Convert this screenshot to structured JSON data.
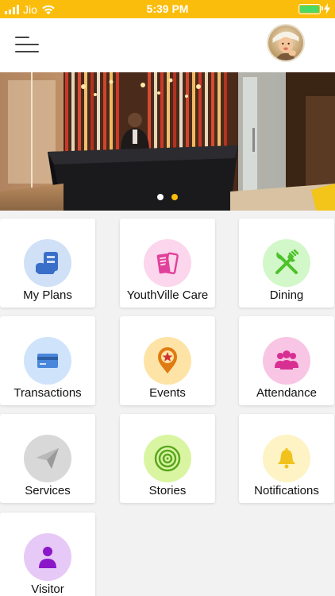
{
  "status_bar": {
    "carrier": "Jio",
    "time": "5:39 PM",
    "signal_icon": "signal-bars-icon",
    "wifi_icon": "wifi-icon",
    "battery_icon": "battery-icon",
    "charging_icon": "charging-bolt-icon",
    "battery_level": 1.0
  },
  "header": {
    "menu_icon": "hamburger-menu-icon",
    "avatar_icon": "profile-avatar"
  },
  "banner": {
    "slide_count": 2,
    "active_slide": 2
  },
  "menu": {
    "items": [
      {
        "label": "My Plans",
        "icon": "plans-icon",
        "bg": "#cfe0f7",
        "color": "#3a6fc9"
      },
      {
        "label": "YouthVille Care",
        "icon": "tickets-icon",
        "bg": "#fbd6ec",
        "color": "#e0419a"
      },
      {
        "label": "Dining",
        "icon": "fork-knife-icon",
        "bg": "#d2f7c8",
        "color": "#4cc22a"
      },
      {
        "label": "Transactions",
        "icon": "credit-card-icon",
        "bg": "#cfe4fb",
        "color": "#4a86d9"
      },
      {
        "label": "Events",
        "icon": "location-star-icon",
        "bg": "#fde4a6",
        "color": "#e07a12"
      },
      {
        "label": "Attendance",
        "icon": "people-group-icon",
        "bg": "#f8c6e4",
        "color": "#d82f93"
      },
      {
        "label": "Services",
        "icon": "paper-plane-icon",
        "bg": "#d8d8d8",
        "color": "#9a9a9a"
      },
      {
        "label": "Stories",
        "icon": "vinyl-record-icon",
        "bg": "#d9f5a2",
        "color": "#5aa61e"
      },
      {
        "label": "Notifications",
        "icon": "bell-icon",
        "bg": "#fdf3c4",
        "color": "#f2c21c"
      },
      {
        "label": "Visitor",
        "icon": "user-icon",
        "bg": "#e6c9f6",
        "color": "#8a18c9"
      }
    ]
  },
  "colors": {
    "accent": "#fbbd0c",
    "page_background": "#f2f2f2",
    "dot_inactive": "#ffffff",
    "dot_active": "#fbbd0c"
  }
}
